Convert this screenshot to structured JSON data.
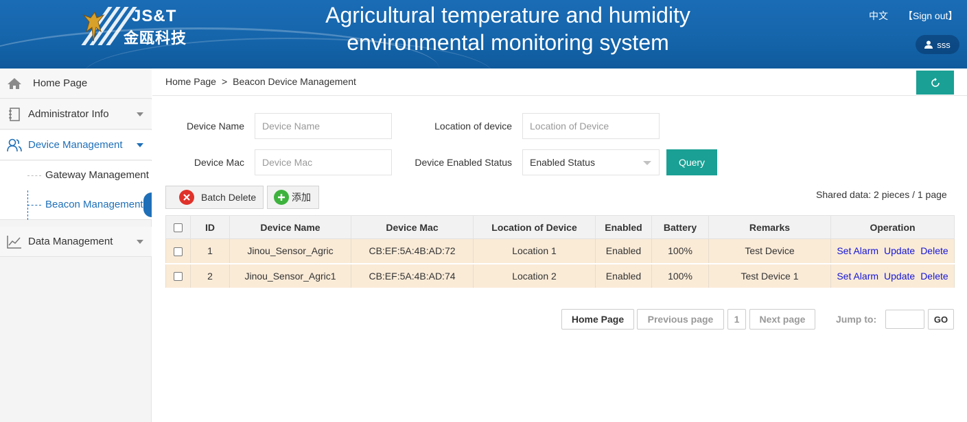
{
  "header": {
    "logo_en": "JS&T",
    "logo_cn": "金瓯科技",
    "title": "Agricultural temperature and humidity environmental monitoring system",
    "lang_link": "中文",
    "signout_link": "【Sign out】",
    "username": "sss"
  },
  "sidebar": {
    "items": [
      {
        "label": "Home Page",
        "icon": "home-icon"
      },
      {
        "label": "Administrator Info",
        "icon": "notebook-icon"
      },
      {
        "label": "Device Management",
        "icon": "users-icon"
      },
      {
        "label": "Data Management",
        "icon": "line-chart-icon"
      }
    ],
    "subitems": [
      {
        "label": "Gateway Management"
      },
      {
        "label": "Beacon Management"
      }
    ]
  },
  "breadcrumb": {
    "root": "Home Page",
    "separator": ">",
    "current": "Beacon Device Management"
  },
  "search": {
    "device_name_label": "Device Name",
    "device_name_placeholder": "Device Name",
    "location_label": "Location of device",
    "location_placeholder": "Location of Device",
    "mac_label": "Device Mac",
    "mac_placeholder": "Device Mac",
    "status_label": "Device Enabled Status",
    "status_value": "Enabled Status",
    "query_label": "Query"
  },
  "actions": {
    "batch_delete": "Batch Delete",
    "add": "添加",
    "shared_data": "Shared data: 2 pieces / 1 page"
  },
  "table": {
    "columns": [
      "ID",
      "Device Name",
      "Device Mac",
      "Location of Device",
      "Enabled",
      "Battery",
      "Remarks",
      "Operation"
    ],
    "rows": [
      {
        "id": "1",
        "name": "Jinou_Sensor_Agric",
        "mac": "CB:EF:5A:4B:AD:72",
        "location": "Location 1",
        "enabled": "Enabled",
        "battery": "100%",
        "remarks": "Test Device"
      },
      {
        "id": "2",
        "name": "Jinou_Sensor_Agric1",
        "mac": "CB:EF:5A:4B:AD:74",
        "location": "Location 2",
        "enabled": "Enabled",
        "battery": "100%",
        "remarks": "Test Device 1"
      }
    ],
    "ops": {
      "set_alarm": "Set Alarm",
      "update": "Update",
      "delete": "Delete"
    }
  },
  "pagination": {
    "home": "Home Page",
    "prev": "Previous page",
    "page": "1",
    "next": "Next page",
    "jump_label": "Jump to:",
    "go": "GO"
  },
  "colors": {
    "header_blue": "#1565ab",
    "accent_teal": "#1aa094",
    "active_blue": "#1e6fb8",
    "row_bg": "#faebd7",
    "link_blue": "#1515d6"
  }
}
